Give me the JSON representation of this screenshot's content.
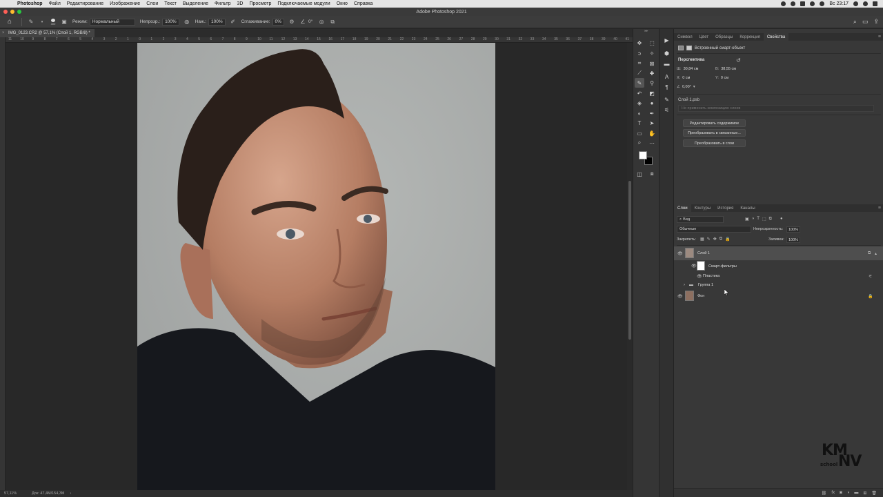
{
  "menubar": {
    "app": "Photoshop",
    "items": [
      "Файл",
      "Редактирование",
      "Изображение",
      "Слои",
      "Текст",
      "Выделение",
      "Фильтр",
      "3D",
      "Просмотр",
      "Подключаемые модули",
      "Окно",
      "Справка"
    ],
    "clock": "Вс 23:17"
  },
  "window": {
    "title": "Adobe Photoshop 2021"
  },
  "options": {
    "brush_size": "300",
    "mode_label": "Режим:",
    "mode_value": "Нормальный",
    "opacity_label": "Непрозр.:",
    "opacity_value": "100%",
    "flow_label": "Наж.:",
    "flow_value": "100%",
    "smoothing_label": "Сглаживание:",
    "smoothing_value": "0%",
    "angle_value": "0°"
  },
  "document": {
    "tab_label": "IMG_0123.CR2 @ 57,1% (Слой 1, RGB/8) *",
    "zoom": "57,11%",
    "doc_size": "Док: 47,4M/154,3M"
  },
  "ruler": {
    "labels": [
      "11",
      "10",
      "9",
      "8",
      "7",
      "6",
      "5",
      "4",
      "3",
      "2",
      "1",
      "0",
      "1",
      "2",
      "3",
      "4",
      "5",
      "6",
      "7",
      "8",
      "9",
      "10",
      "11",
      "12",
      "13",
      "14",
      "15",
      "16",
      "17",
      "18",
      "19",
      "20",
      "21",
      "22",
      "23",
      "24",
      "25",
      "26",
      "27",
      "28",
      "29",
      "30",
      "31",
      "32",
      "33",
      "34",
      "35",
      "36",
      "37",
      "38",
      "39",
      "40",
      "41"
    ]
  },
  "properties": {
    "tabs": [
      "Символ",
      "Цвет",
      "Образцы",
      "Коррекция",
      "Свойства"
    ],
    "active_tab": "Свойства",
    "type_label": "Встроенный смарт-объект",
    "section": "Перспектива",
    "w_label": "Ш:",
    "w_value": "30,84 см",
    "h_label": "В:",
    "h_value": "38,55 см",
    "x_label": "X:",
    "x_value": "0 см",
    "y_label": "Y:",
    "y_value": "0 см",
    "angle_value": "0,00°",
    "file": "Слой 1.psb",
    "comp_placeholder": "Не применить композицию слоев",
    "buttons": [
      "Редактировать содержимое",
      "Преобразовать в связанные...",
      "Преобразовать в слои"
    ]
  },
  "layers": {
    "tabs": [
      "Слои",
      "Контуры",
      "История",
      "Каналы"
    ],
    "active_tab": "Слои",
    "filter_label": "Вид",
    "blend_mode": "Обычные",
    "opacity_label": "Непрозрачность:",
    "opacity_value": "100%",
    "lock_label": "Закрепить:",
    "fill_label": "Заливка:",
    "fill_value": "100%",
    "items": [
      {
        "name": "Слой 1",
        "selected": true
      },
      {
        "name": "Смарт-фильтры"
      },
      {
        "name": "Пластика"
      },
      {
        "name": "Группа 1"
      },
      {
        "name": "Фон"
      }
    ]
  },
  "watermark": {
    "line1": "KM",
    "line2": "NV",
    "line3": "school"
  },
  "colors": {
    "accent": "#4e4e4e",
    "panel": "#383838",
    "canvas": "#282828",
    "foreground": "#ffffff",
    "background": "#000000"
  }
}
